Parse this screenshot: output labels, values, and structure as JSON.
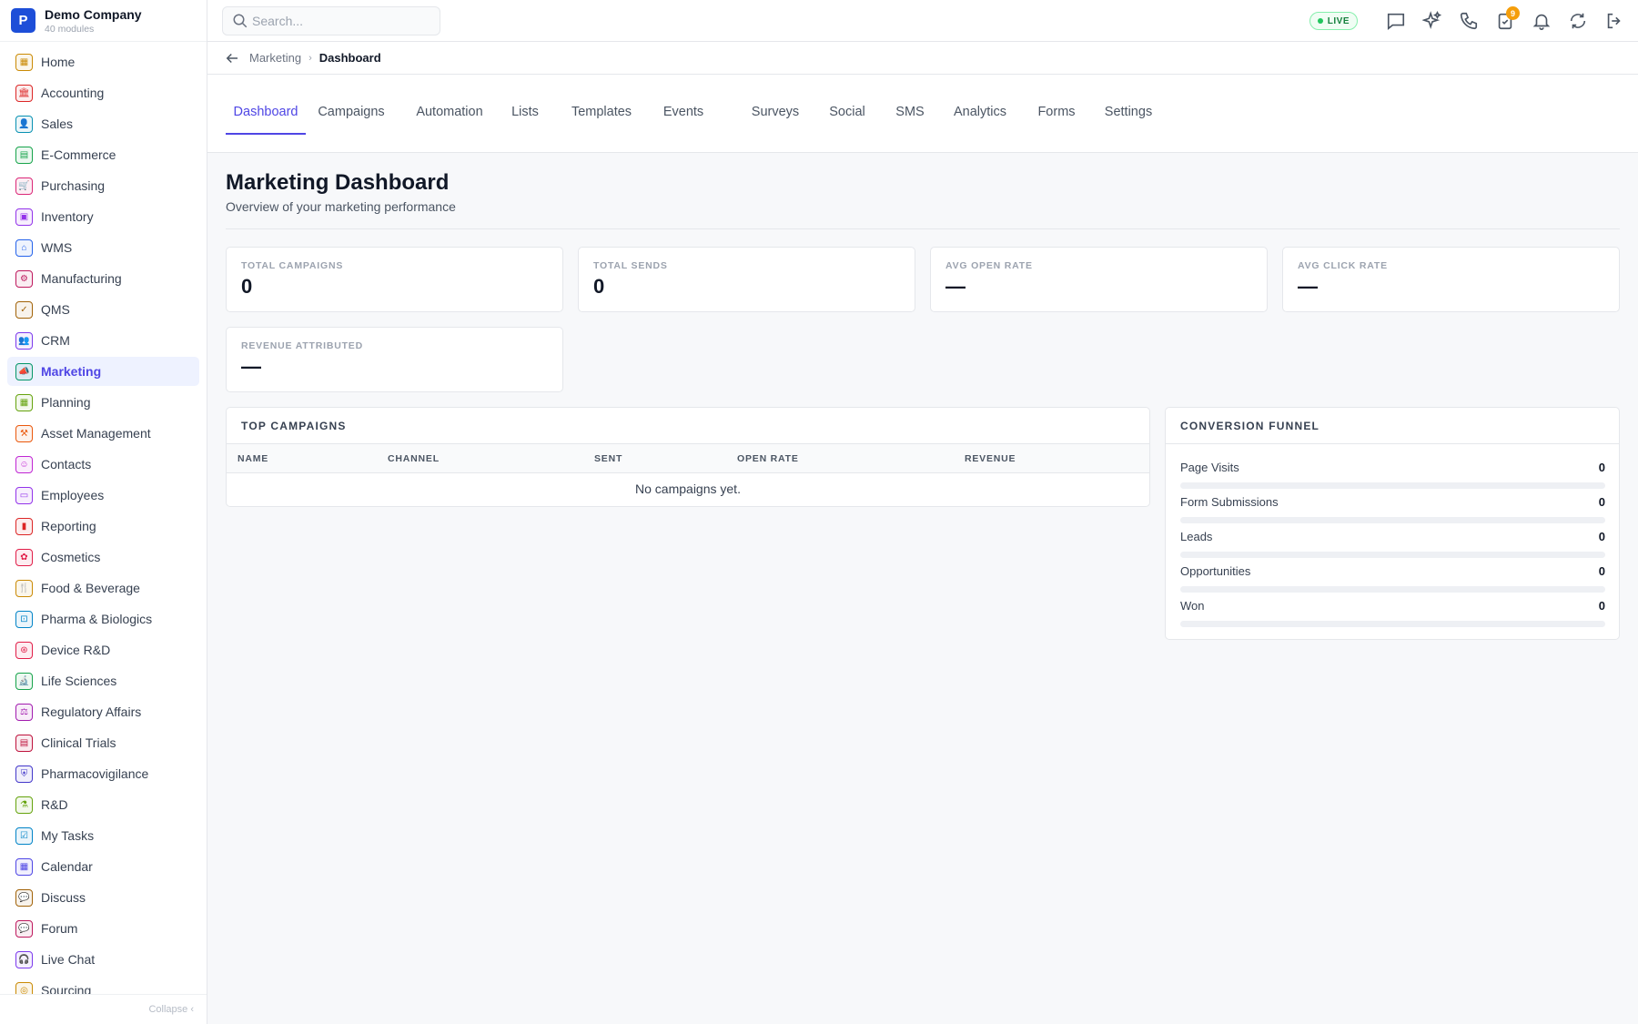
{
  "brand": {
    "logo": "P",
    "name": "Demo Company",
    "subtitle": "40 modules"
  },
  "sidebar": {
    "items": [
      {
        "label": "Home",
        "icon": "grid-icon",
        "glyph": "▦",
        "color": "#ca8a04"
      },
      {
        "label": "Accounting",
        "icon": "bank-icon",
        "glyph": "🏛",
        "color": "#dc2626"
      },
      {
        "label": "Sales",
        "icon": "user-icon",
        "glyph": "👤",
        "color": "#0891b2"
      },
      {
        "label": "E-Commerce",
        "icon": "store-icon",
        "glyph": "▤",
        "color": "#16a34a"
      },
      {
        "label": "Purchasing",
        "icon": "cart-icon",
        "glyph": "🛒",
        "color": "#db2777"
      },
      {
        "label": "Inventory",
        "icon": "box-icon",
        "glyph": "▣",
        "color": "#9333ea"
      },
      {
        "label": "WMS",
        "icon": "warehouse-icon",
        "glyph": "⌂",
        "color": "#2563eb"
      },
      {
        "label": "Manufacturing",
        "icon": "factory-icon",
        "glyph": "⚙",
        "color": "#be185d"
      },
      {
        "label": "QMS",
        "icon": "badge-check-icon",
        "glyph": "✓",
        "color": "#a16207"
      },
      {
        "label": "CRM",
        "icon": "users-icon",
        "glyph": "👥",
        "color": "#7c3aed"
      },
      {
        "label": "Marketing",
        "icon": "megaphone-icon",
        "glyph": "📣",
        "color": "#059669",
        "active": true
      },
      {
        "label": "Planning",
        "icon": "calendar-grid-icon",
        "glyph": "▦",
        "color": "#65a30d"
      },
      {
        "label": "Asset Management",
        "icon": "tools-icon",
        "glyph": "⚒",
        "color": "#ea580c"
      },
      {
        "label": "Contacts",
        "icon": "contact-icon",
        "glyph": "☺",
        "color": "#c026d3"
      },
      {
        "label": "Employees",
        "icon": "briefcase-icon",
        "glyph": "▭",
        "color": "#9333ea"
      },
      {
        "label": "Reporting",
        "icon": "bar-chart-icon",
        "glyph": "▮",
        "color": "#dc2626"
      },
      {
        "label": "Cosmetics",
        "icon": "flower-icon",
        "glyph": "✿",
        "color": "#e11d48"
      },
      {
        "label": "Food & Beverage",
        "icon": "utensils-icon",
        "glyph": "🍴",
        "color": "#ca8a04"
      },
      {
        "label": "Pharma & Biologics",
        "icon": "pill-bottle-icon",
        "glyph": "⊡",
        "color": "#0284c7"
      },
      {
        "label": "Device R&D",
        "icon": "chip-icon",
        "glyph": "⊛",
        "color": "#e11d48"
      },
      {
        "label": "Life Sciences",
        "icon": "microscope-icon",
        "glyph": "🔬",
        "color": "#16a34a"
      },
      {
        "label": "Regulatory Affairs",
        "icon": "gavel-icon",
        "glyph": "⚖",
        "color": "#a21caf"
      },
      {
        "label": "Clinical Trials",
        "icon": "clipboard-icon",
        "glyph": "▤",
        "color": "#be123c"
      },
      {
        "label": "Pharmacovigilance",
        "icon": "shield-icon",
        "glyph": "⛨",
        "color": "#4338ca"
      },
      {
        "label": "R&D",
        "icon": "flask-icon",
        "glyph": "⚗",
        "color": "#65a30d"
      },
      {
        "label": "My Tasks",
        "icon": "checklist-icon",
        "glyph": "☑",
        "color": "#0284c7"
      },
      {
        "label": "Calendar",
        "icon": "calendar-icon",
        "glyph": "▦",
        "color": "#4f46e5"
      },
      {
        "label": "Discuss",
        "icon": "chat-icon",
        "glyph": "💬",
        "color": "#a16207"
      },
      {
        "label": "Forum",
        "icon": "messages-icon",
        "glyph": "💬",
        "color": "#be185d"
      },
      {
        "label": "Live Chat",
        "icon": "headset-icon",
        "glyph": "🎧",
        "color": "#7c3aed"
      },
      {
        "label": "Sourcing",
        "icon": "search-doc-icon",
        "glyph": "◎",
        "color": "#ca8a04"
      }
    ],
    "collapse_label": "Collapse ‹"
  },
  "topbar": {
    "search_placeholder": "Search...",
    "live_label": "LIVE",
    "approvals_badge": "9",
    "icons": [
      "message-icon",
      "sparkles-icon",
      "phone-icon",
      "clipboard-check-icon",
      "bell-icon",
      "sync-icon",
      "logout-icon"
    ]
  },
  "breadcrumb": {
    "parent": "Marketing",
    "separator": "›",
    "current": "Dashboard"
  },
  "tabs": [
    "Dashboard",
    "Campaigns",
    "Automation",
    "Lists",
    "Templates",
    "Events",
    "Surveys",
    "Social",
    "SMS",
    "Analytics",
    "Forms",
    "Settings"
  ],
  "page": {
    "title": "Marketing Dashboard",
    "subtitle": "Overview of your marketing performance"
  },
  "kpis": [
    {
      "label": "TOTAL CAMPAIGNS",
      "value": "0"
    },
    {
      "label": "TOTAL SENDS",
      "value": "0"
    },
    {
      "label": "AVG OPEN RATE",
      "value": "—"
    },
    {
      "label": "AVG CLICK RATE",
      "value": "—"
    },
    {
      "label": "REVENUE ATTRIBUTED",
      "value": "—"
    }
  ],
  "top_campaigns": {
    "title": "TOP CAMPAIGNS",
    "columns": [
      "NAME",
      "CHANNEL",
      "SENT",
      "OPEN RATE",
      "REVENUE"
    ],
    "empty_text": "No campaigns yet."
  },
  "funnel": {
    "title": "CONVERSION FUNNEL",
    "stages": [
      {
        "label": "Page Visits",
        "value": "0",
        "fill": 0
      },
      {
        "label": "Form Submissions",
        "value": "0",
        "fill": 0
      },
      {
        "label": "Leads",
        "value": "0",
        "fill": 0
      },
      {
        "label": "Opportunities",
        "value": "0",
        "fill": 0
      },
      {
        "label": "Won",
        "value": "0",
        "fill": 0
      }
    ]
  }
}
